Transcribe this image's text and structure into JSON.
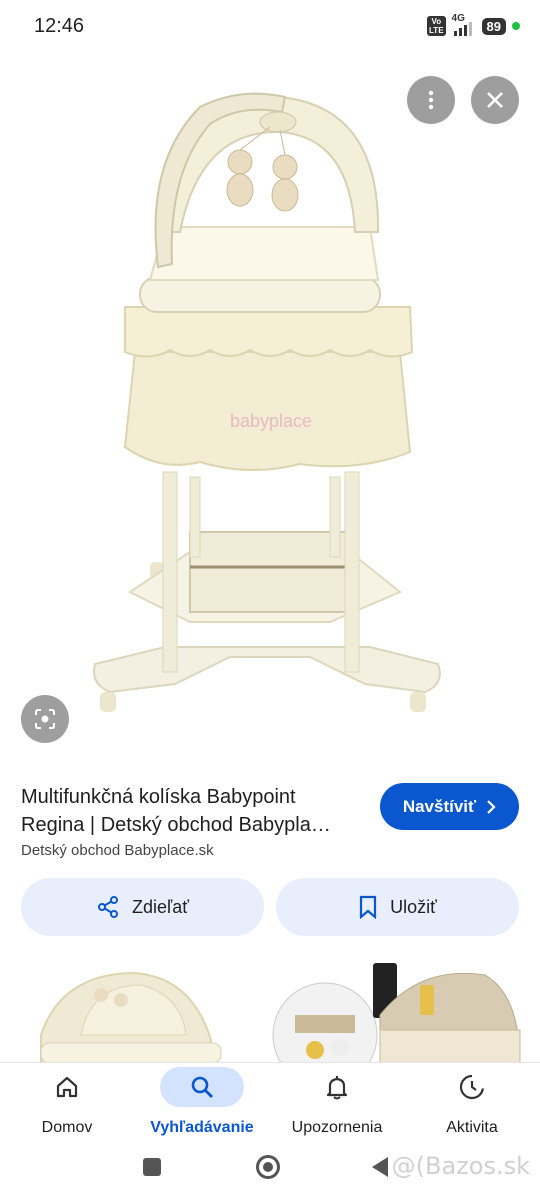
{
  "status_bar": {
    "time": "12:46",
    "volte": "Vo\nLTE",
    "network": "4G",
    "battery": "89"
  },
  "viewer": {
    "image_watermark": "babyplace",
    "more_icon": "more-vert-icon",
    "close_icon": "close-icon",
    "lens_icon": "lens-icon"
  },
  "result": {
    "title_line1": "Multifunkčná kolíska Babypoint",
    "title_line2": "Regina | Detský obchod Babypla…",
    "source": "Detský obchod Babyplace.sk",
    "visit_label": "Navštíviť",
    "share_label": "Zdieľať",
    "save_label": "Uložiť"
  },
  "bottom_nav": {
    "items": [
      {
        "label": "Domov",
        "icon": "home-icon"
      },
      {
        "label": "Vyhľadávanie",
        "icon": "search-icon",
        "active": true
      },
      {
        "label": "Upozornenia",
        "icon": "bell-icon"
      },
      {
        "label": "Aktivita",
        "icon": "activity-icon"
      }
    ]
  },
  "watermark": "@(Bazos.sk",
  "colors": {
    "accent": "#0b57d0",
    "chip_bg": "#e8eefc",
    "active_pill": "#d3e3fd",
    "overlay_btn": "#9e9e9e"
  }
}
